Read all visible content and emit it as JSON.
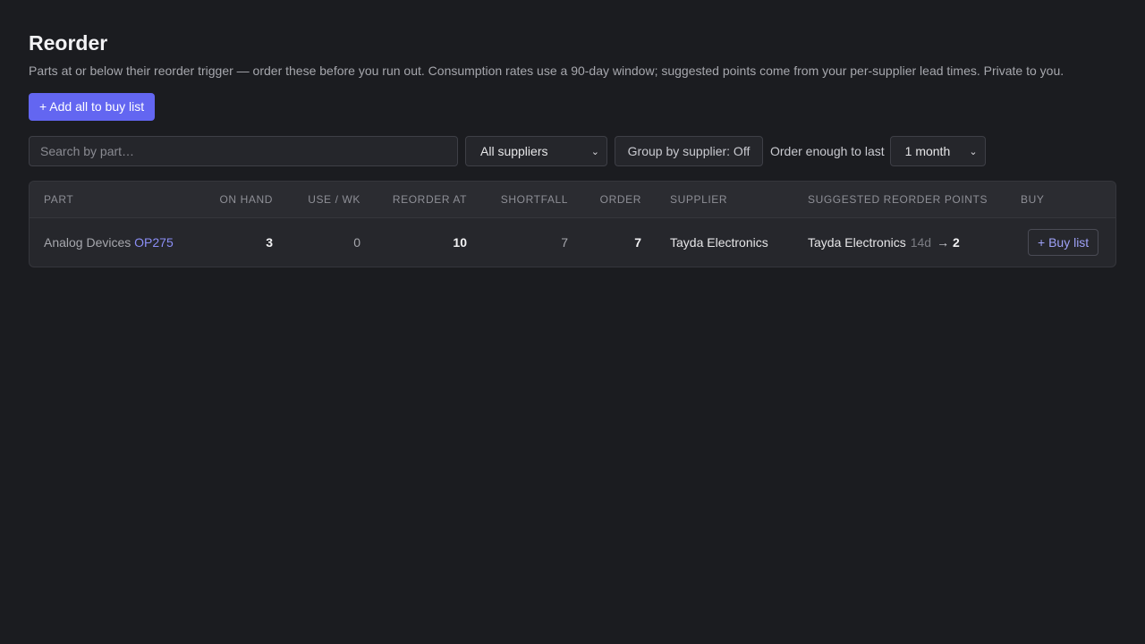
{
  "page": {
    "title": "Reorder",
    "subtitle": "Parts at or below their reorder trigger — order these before you run out. Consumption rates use a 90-day window; suggested points come from your per-supplier lead times. Private to you.",
    "add_all_label": "+ Add all to buy list"
  },
  "filters": {
    "search_placeholder": "Search by part…",
    "supplier_selected": "All suppliers",
    "group_toggle_label": "Group by supplier: Off",
    "horizon_label": "Order enough to last",
    "horizon_selected": "1 month"
  },
  "table": {
    "headers": {
      "part": "PART",
      "on_hand": "ON HAND",
      "use_wk": "USE / WK",
      "reorder_at": "REORDER AT",
      "shortfall": "SHORTFALL",
      "order": "ORDER",
      "supplier": "SUPPLIER",
      "suggested": "SUGGESTED REORDER POINTS",
      "buy": "BUY"
    },
    "rows": [
      {
        "manufacturer": "Analog Devices",
        "part_number": "OP275",
        "on_hand": "3",
        "use_wk": "0",
        "reorder_at": "10",
        "shortfall": "7",
        "order": "7",
        "supplier": "Tayda Electronics",
        "suggested_supplier": "Tayda Electronics",
        "suggested_lead": "14d",
        "suggested_arrow": "→",
        "suggested_point": "2",
        "buy_label": "+ Buy list"
      }
    ]
  }
}
